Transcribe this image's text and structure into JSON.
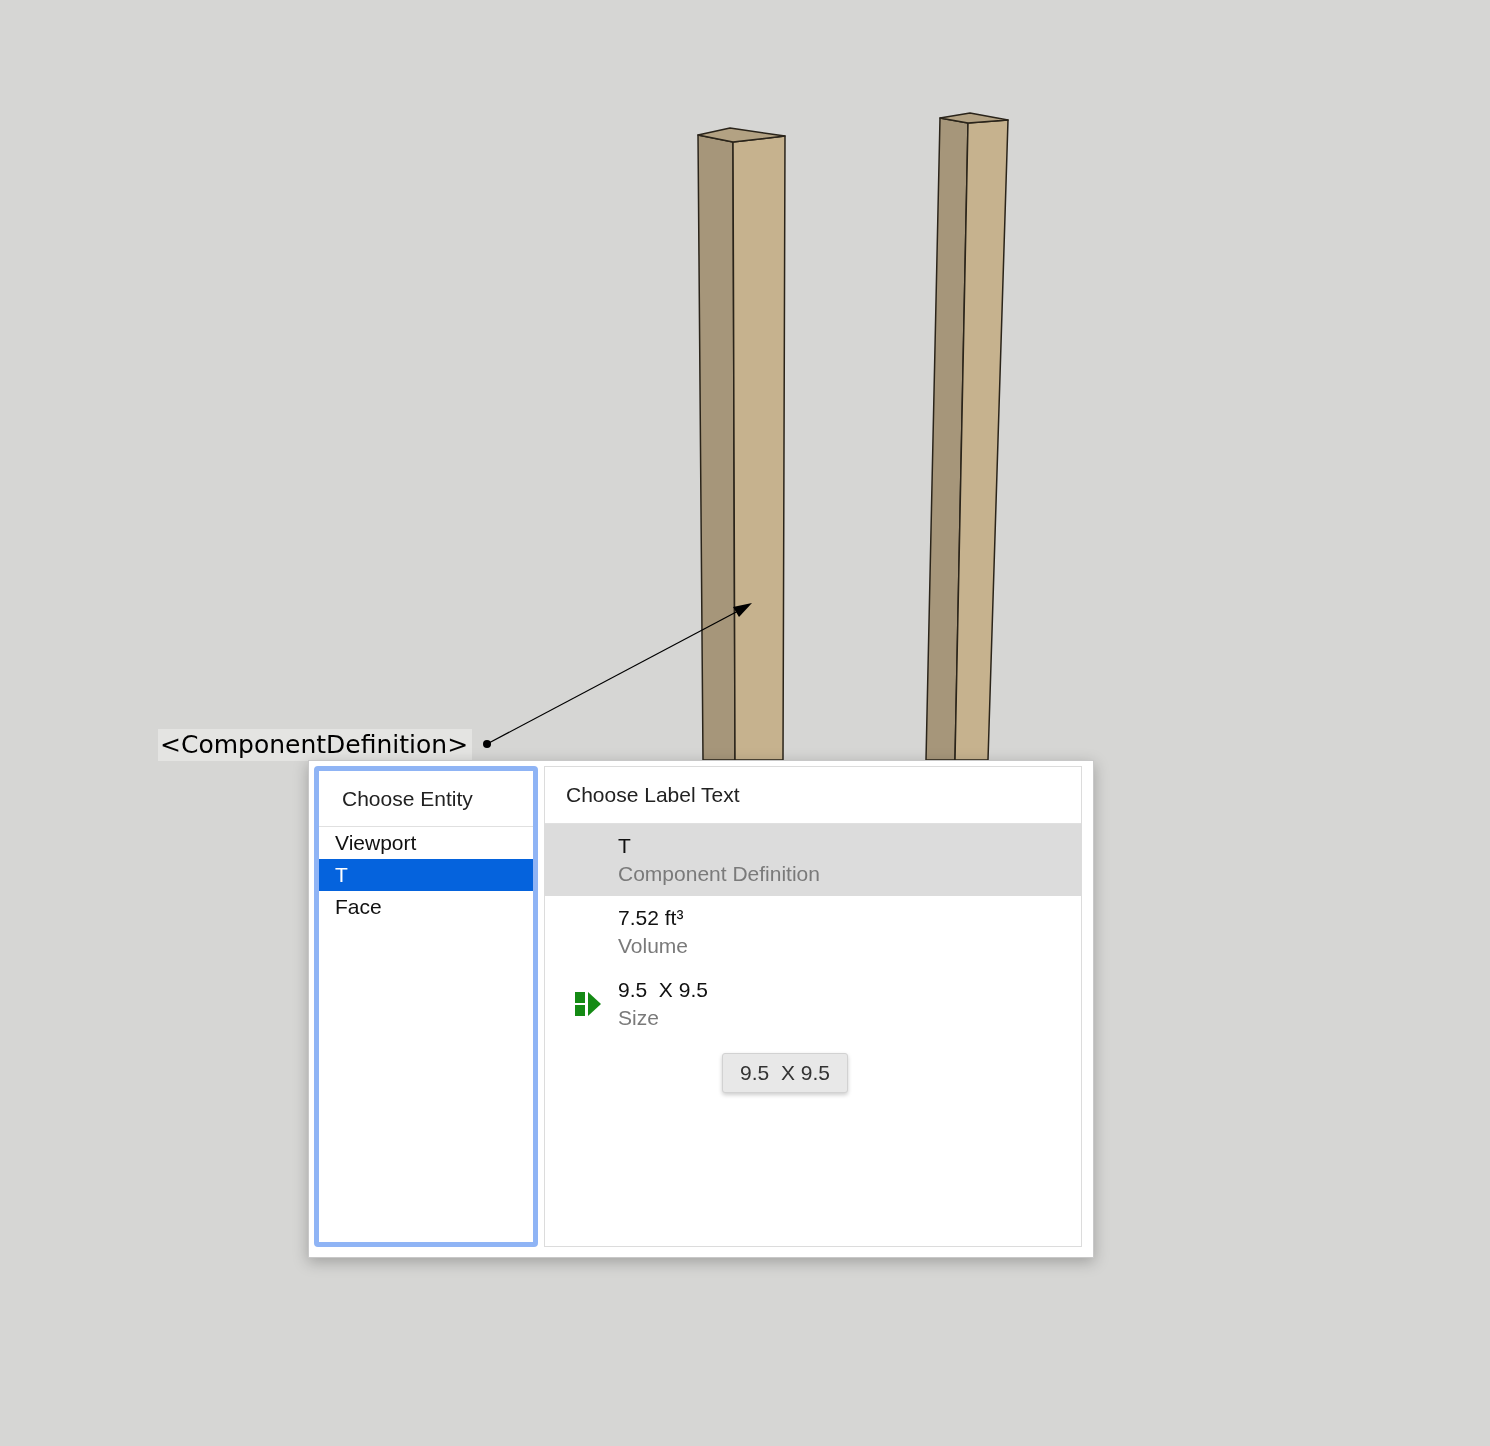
{
  "leader_label": "<ComponentDefinition>",
  "entity_panel": {
    "title": "Choose Entity",
    "items": [
      {
        "label": "Viewport",
        "selected": false
      },
      {
        "label": "T",
        "selected": true
      },
      {
        "label": "Face",
        "selected": false
      }
    ]
  },
  "label_text_panel": {
    "title": "Choose Label Text",
    "options": [
      {
        "value": "T",
        "caption": "Component Definition",
        "selected": true,
        "current": false
      },
      {
        "value": "7.52 ft³",
        "caption": "Volume",
        "selected": false,
        "current": false
      },
      {
        "value": "9.5  X 9.5",
        "caption": "Size",
        "selected": false,
        "current": true
      }
    ]
  },
  "tooltip": "9.5  X 9.5"
}
